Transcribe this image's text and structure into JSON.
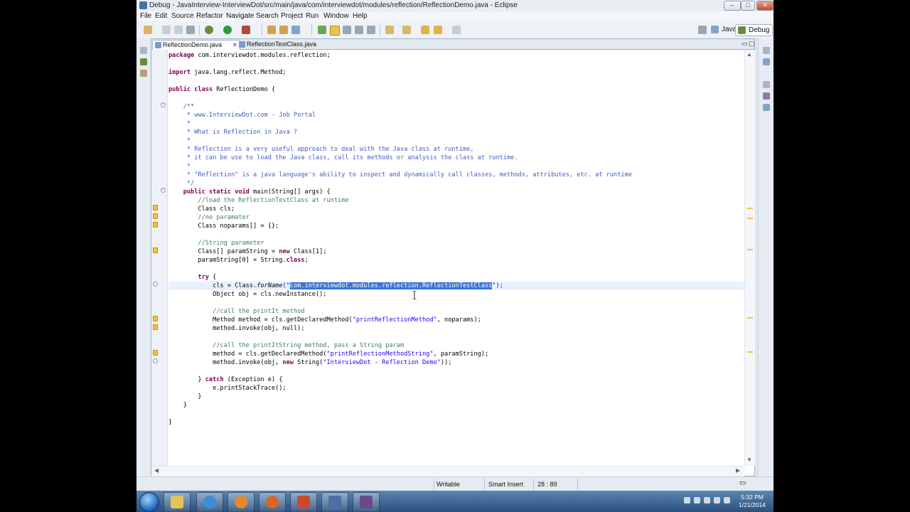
{
  "window": {
    "title": "Debug - JavaInterview-InterviewDot/src/main/java/com/interviewdot/modules/reflection/ReflectionDemo.java - Eclipse",
    "controls": {
      "minimize": "–",
      "maximize": "□",
      "close": "✕"
    }
  },
  "menu": [
    "File",
    "Edit",
    "Source",
    "Refactor",
    "Navigate",
    "Search",
    "Project",
    "Run",
    "Window",
    "Help"
  ],
  "perspectives": {
    "java": "Java",
    "debug": "Debug"
  },
  "editor": {
    "tabs": [
      {
        "label": "ReflectionDemo.java",
        "active": true
      },
      {
        "label": "ReflectionTestClass.java",
        "active": false
      }
    ],
    "code": {
      "l1_kw": "package",
      "l1_rest": " com.interviewdot.modules.reflection;",
      "l2_kw": "import",
      "l2_rest": " java.lang.reflect.Method;",
      "l3_kw": "public class",
      "l3_rest": " ReflectionDemo {",
      "d1": "    /**",
      "d2": "     * www.InterviewDot.com - Job Portal",
      "d3": "     *",
      "d4": "     * What is Reflection in Java ?",
      "d5": "     *",
      "d6": "     * Reflection is a very useful approach to deal with the Java class at runtime,",
      "d7": "     * it can be use to load the Java class, call its methods or analysis the class at runtime.",
      "d8": "     *",
      "d9": "     * \"Reflection\" is a java language's ability to inspect and dynamically call classes, methods, attributes, etc. at runtime",
      "d10": "     */",
      "m_kw": "    public static void",
      "m_rest": " main(String[] args) {",
      "c1": "        //load the ReflectionTestClass at runtime",
      "s1": "        Class cls;",
      "c2": "        //no paramater",
      "s2": "        Class noparams[] = {};",
      "c3": "        //String parameter",
      "s3a": "        Class[] paramString = ",
      "s3kw": "new",
      "s3b": " Class[1];",
      "s4a": "        paramString[0] = String.",
      "s4kw": "class",
      "s4b": ";",
      "t_kw": "        try",
      "t_rest": " {",
      "f1a": "            cls = Class.",
      "f1it": "forName",
      "f1b": "(\"",
      "f1sel": "com.interviewdot.modules.reflection.ReflectionTestClass",
      "f1c": "\");",
      "f2": "            Object obj = cls.newInstance();",
      "c4": "            //call the printIt method",
      "f3a": "            Method method = cls.getDeclaredMethod(",
      "f3s": "\"printReflectionMethod\"",
      "f3b": ", noparams);",
      "f4": "            method.invoke(obj, null);",
      "c5": "            //call the printItString method, pass a String param",
      "f5a": "            method = cls.getDeclaredMethod(",
      "f5s": "\"printReflectionMethodString\"",
      "f5b": ", paramString);",
      "f6a": "            method.invoke(obj, ",
      "f6kw": "new",
      "f6b": " String(",
      "f6s": "\"InterviewDot - Reflection Demo\"",
      "f6c": "));",
      "x1a": "        } ",
      "x1kw": "catch",
      "x1b": " (Exception e) {",
      "x2": "            e.printStackTrace();",
      "x3": "        }",
      "x4": "    }",
      "x5": "}"
    }
  },
  "status": {
    "writable": "Writable",
    "insert_mode": "Smart Insert",
    "position": "28 : 89"
  },
  "clock": {
    "time": "5:32 PM",
    "date": "1/21/2014"
  },
  "colors": {
    "keyword": "#7f0055",
    "comment": "#3f7f5f",
    "javadoc": "#3f5fbf",
    "string": "#2a00ff",
    "selection": "#3875d7"
  }
}
